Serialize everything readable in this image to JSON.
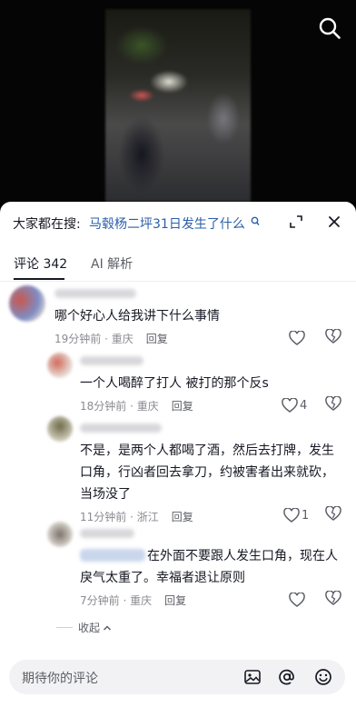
{
  "video": {
    "search_icon": "search-icon"
  },
  "search_suggest": {
    "prefix": "大家都在搜:",
    "query": "马毂杨二坪31日发生了什么",
    "query_icon": "search-q-icon",
    "expand_icon": "expand-icon",
    "close_icon": "close-icon"
  },
  "tabs": [
    {
      "label": "评论 342",
      "active": true
    },
    {
      "label": "AI 解析",
      "active": false
    }
  ],
  "comments": [
    {
      "text": "哪个好心人给我讲下什么事情",
      "time": "19分钟前 · 重庆",
      "reply": "回复",
      "likes": ""
    },
    {
      "text": "一个人喝醉了打人 被打的那个反s",
      "time": "18分钟前 · 重庆",
      "reply": "回复",
      "likes": "4"
    },
    {
      "text": "不是，是两个人都喝了酒，然后去打牌，发生口角，行凶者回去拿刀，约被害者出来就砍，当场没了",
      "time": "11分钟前 · 浙江",
      "reply": "回复",
      "likes": "1"
    },
    {
      "text": "在外面不要跟人发生口角，现在人戾气太重了。幸福者退让原则",
      "time": "7分钟前 · 重庆",
      "reply": "回复",
      "likes": ""
    }
  ],
  "collapse_label": "收起",
  "input": {
    "placeholder": "期待你的评论",
    "icons": [
      "image-icon",
      "at-icon",
      "emoji-icon"
    ]
  },
  "colors": {
    "link": "#2a5ea9",
    "text": "#161823",
    "meta": "#8a8b91"
  }
}
